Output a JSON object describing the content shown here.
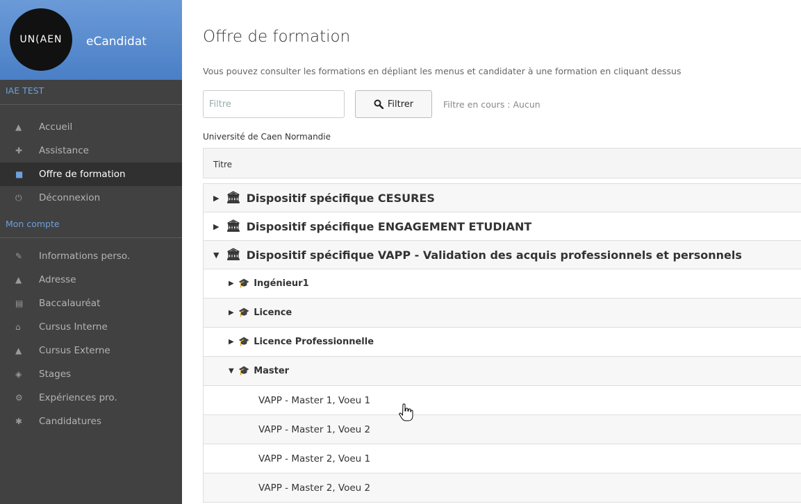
{
  "brand": {
    "logo_text": "UN(AEN",
    "app_name": "eCandidat"
  },
  "sidebar": {
    "section_main": "IAE TEST",
    "items": [
      {
        "label": "Accueil",
        "icon": "home-icon",
        "glyph": "▲"
      },
      {
        "label": "Assistance",
        "icon": "ambulance-icon",
        "glyph": "✚"
      },
      {
        "label": "Offre de formation",
        "icon": "bookmark-icon",
        "glyph": "■"
      },
      {
        "label": "Déconnexion",
        "icon": "power-icon",
        "glyph": "⏻"
      }
    ],
    "section_account": "Mon compte",
    "account_items": [
      {
        "label": "Informations perso.",
        "icon": "pencil-icon",
        "glyph": "✎"
      },
      {
        "label": "Adresse",
        "icon": "home-icon",
        "glyph": "▲"
      },
      {
        "label": "Baccalauréat",
        "icon": "book-icon",
        "glyph": "▤"
      },
      {
        "label": "Cursus Interne",
        "icon": "institution-icon",
        "glyph": "⌂"
      },
      {
        "label": "Cursus Externe",
        "icon": "graduation-cap-icon",
        "glyph": "▲"
      },
      {
        "label": "Stages",
        "icon": "cube-icon",
        "glyph": "◈"
      },
      {
        "label": "Expériences pro.",
        "icon": "cogs-icon",
        "glyph": "⚙"
      },
      {
        "label": "Candidatures",
        "icon": "asterisk-icon",
        "glyph": "✱"
      }
    ]
  },
  "main": {
    "title": "Offre de formation",
    "intro": "Vous pouvez consulter les formations en dépliant les menus et candidater à une formation en cliquant dessus",
    "filter": {
      "placeholder": "Filtre",
      "button_label": "Filtrer",
      "status": "Filtre en cours : Aucun"
    },
    "university": "Université de Caen Normandie",
    "table": {
      "header": "Titre",
      "rows": [
        {
          "level": 1,
          "expanded": false,
          "label": "Dispositif spécifique CESURES"
        },
        {
          "level": 1,
          "expanded": false,
          "label": "Dispositif spécifique ENGAGEMENT ETUDIANT"
        },
        {
          "level": 1,
          "expanded": true,
          "label": "Dispositif spécifique VAPP - Validation des acquis professionnels et personnels"
        },
        {
          "level": 2,
          "expanded": false,
          "label": "Ingénieur1"
        },
        {
          "level": 2,
          "expanded": false,
          "label": "Licence"
        },
        {
          "level": 2,
          "expanded": false,
          "label": "Licence Professionnelle"
        },
        {
          "level": 2,
          "expanded": true,
          "label": "Master"
        },
        {
          "level": 3,
          "label": "VAPP - Master 1, Voeu 1"
        },
        {
          "level": 3,
          "label": "VAPP - Master 1, Voeu 2"
        },
        {
          "level": 3,
          "label": "VAPP - Master 2, Voeu 1"
        },
        {
          "level": 3,
          "label": "VAPP - Master 2, Voeu 2"
        }
      ]
    }
  },
  "colors": {
    "sidebar_bg": "#414141",
    "brand_blue": "#5b8ed4",
    "accent_blue": "#6ea0dc"
  }
}
